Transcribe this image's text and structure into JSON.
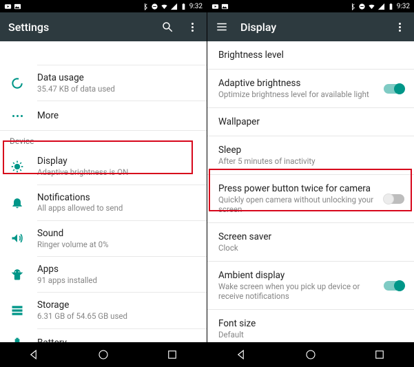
{
  "status": {
    "time": "9:32"
  },
  "left": {
    "title": "Settings",
    "partial_sub": " ",
    "section_device": "Device",
    "items": {
      "data_usage": {
        "title": "Data usage",
        "sub": "35.47 KB of data used"
      },
      "more": {
        "title": "More"
      },
      "display": {
        "title": "Display",
        "sub": "Adaptive brightness is ON"
      },
      "notifications": {
        "title": "Notifications",
        "sub": "All apps allowed to send"
      },
      "sound": {
        "title": "Sound",
        "sub": "Ringer volume at 0%"
      },
      "apps": {
        "title": "Apps",
        "sub": "91 apps installed"
      },
      "storage": {
        "title": "Storage",
        "sub": "6.31 GB of 54.65 GB used"
      },
      "battery": {
        "title": "Battery"
      }
    }
  },
  "right": {
    "title": "Display",
    "items": {
      "brightness": {
        "title": "Brightness level"
      },
      "adaptive": {
        "title": "Adaptive brightness",
        "sub": "Optimize brightness level for available light",
        "toggle": "on"
      },
      "wallpaper": {
        "title": "Wallpaper"
      },
      "sleep": {
        "title": "Sleep",
        "sub": "After 5 minutes of inactivity"
      },
      "power_camera": {
        "title": "Press power button twice for camera",
        "sub": "Quickly open camera without unlocking your screen",
        "toggle": "off"
      },
      "screensaver": {
        "title": "Screen saver",
        "sub": "Clock"
      },
      "ambient": {
        "title": "Ambient display",
        "sub": "Wake screen when you pick up device or receive notifications",
        "toggle": "on"
      },
      "font": {
        "title": "Font size",
        "sub": "Default"
      }
    }
  }
}
